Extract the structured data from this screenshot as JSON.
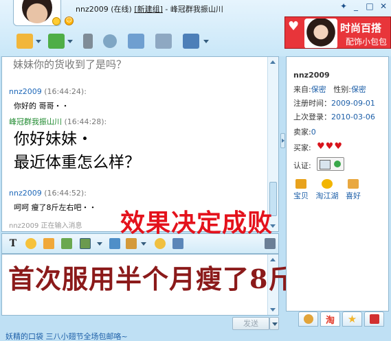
{
  "title": {
    "user": "nnz2009",
    "status": "(在线)",
    "new_group": "[新建组]",
    "separator": " - ",
    "group_name": "峰冠群我振山川"
  },
  "window_controls": {
    "pin": "✦",
    "minimize": "_",
    "maximize": "□",
    "close": "✕"
  },
  "toolbar": {
    "buttons": [
      {
        "name": "chat-tools-button",
        "icon": "chat-window-icon",
        "color": "#f2b63a"
      },
      {
        "name": "send-file-button",
        "icon": "transfer-file-icon",
        "color": "#4fae47"
      },
      {
        "name": "voice-button",
        "icon": "microphone-icon",
        "color": "#7f8c97"
      },
      {
        "name": "video-button",
        "icon": "webcam-icon",
        "color": "#7fa6c4"
      },
      {
        "name": "group-button",
        "icon": "people-icon",
        "color": "#6f9fd0"
      },
      {
        "name": "app-button",
        "icon": "application-window-icon",
        "color": "#8ea8c2"
      },
      {
        "name": "friend-button",
        "icon": "contact-icon",
        "color": "#4d7fb8"
      }
    ]
  },
  "ad": {
    "line1": "时尚百搭",
    "line2": "配饰小包包",
    "colors": {
      "bg": "#e8353a"
    }
  },
  "chat": {
    "partial_message": "妹妹你的货收到了是吗？",
    "messages": [
      {
        "sender": "nnz2009",
        "time": "(16:44:24):",
        "text": "你好的  哥哥・・",
        "self": false
      },
      {
        "sender": "峰冠群我振山川",
        "time": "(16:44:28):",
        "text_lines": [
          "你好妹妹・",
          "最近体重怎么样？"
        ],
        "self": true
      },
      {
        "sender": "nnz2009",
        "time": "(16:44:52):",
        "text": "呵呵   瘦了8斤左右吧・・",
        "self": false
      }
    ],
    "typing": "nnz2009  正在输入消息"
  },
  "overlay": {
    "headline": "效果决定成败",
    "caption": "首次服用半个月瘦了8斤！"
  },
  "input_toolbar": {
    "font_label": "T",
    "tools": [
      {
        "name": "font-button",
        "icon": "font-icon"
      },
      {
        "name": "emoji-button",
        "icon": "smiley-icon",
        "color": "#f6c23b"
      },
      {
        "name": "magic-emoji-button",
        "icon": "magic-face-icon",
        "color": "#f0a83a"
      },
      {
        "name": "shake-button",
        "icon": "shake-window-icon",
        "color": "#6aa84f"
      },
      {
        "name": "screenshot-button",
        "icon": "screenshot-icon",
        "color": "#6b9a4f"
      },
      {
        "name": "image-button",
        "icon": "picture-icon",
        "color": "#4f8fc8"
      },
      {
        "name": "voice-msg-button",
        "icon": "music-note-icon",
        "color": "#d49a3a"
      },
      {
        "name": "gift-button",
        "icon": "gift-icon",
        "color": "#f0c040"
      },
      {
        "name": "history-button",
        "icon": "chat-history-icon",
        "color": "#5b86b8"
      },
      {
        "name": "settings-button",
        "icon": "wrench-icon",
        "color": "#6b7f96"
      }
    ]
  },
  "send": {
    "label": "发送"
  },
  "status_bar": {
    "link": "妖精的口袋  三八小翅节全场包邮咯~"
  },
  "profile": {
    "name": "nnz2009",
    "from_label": "来自:",
    "from_value": "保密",
    "gender_label": "性别:",
    "gender_value": "保密",
    "register_label": "注册时间：",
    "register_value": "2009-09-01",
    "last_login_label": "上次登录：",
    "last_login_value": "2010-03-06",
    "seller_label": "卖家:",
    "seller_value": "0",
    "buyer_label": "买家:",
    "buyer_hearts": 3,
    "cert_label": "认证:",
    "apps": [
      {
        "label": "宝贝",
        "icon": "treasure-icon",
        "color": "#e8a21c"
      },
      {
        "label": "淘江湖",
        "icon": "taojianghu-icon",
        "color": "#f2b500"
      },
      {
        "label": "喜好",
        "icon": "favorites-icon",
        "color": "#e9a840"
      }
    ]
  },
  "side_tabs": [
    {
      "name": "tab-chat",
      "icon": "speech-bubble-icon",
      "color": "#e2a43a"
    },
    {
      "name": "tab-taobao",
      "label": "淘",
      "icon": "taobao-icon",
      "color": "#e23a2a"
    },
    {
      "name": "tab-star",
      "icon": "star-icon",
      "color": "#f2b52c"
    },
    {
      "name": "tab-shop",
      "icon": "shirt-icon",
      "color": "#d23030"
    }
  ]
}
